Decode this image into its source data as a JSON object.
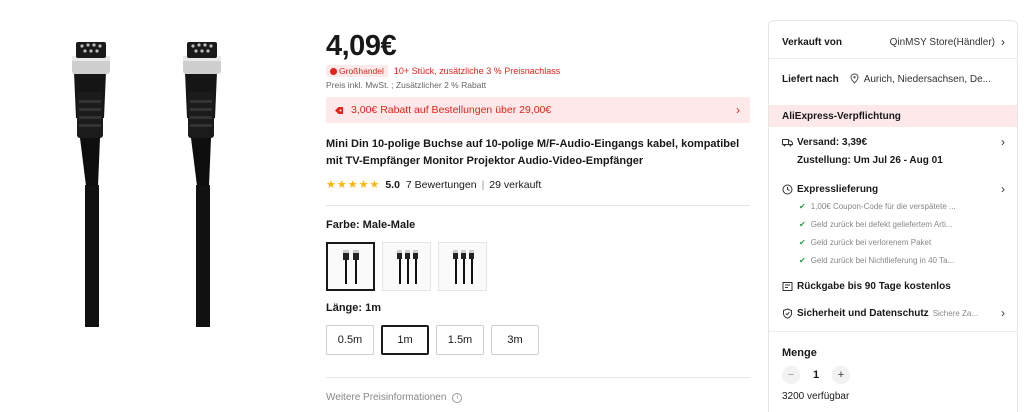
{
  "product": {
    "price": "4,09€",
    "bulk_badge": "Großhandel",
    "bulk_text": "10+ Stück, zusätzliche 3 % Preisnachlass",
    "tax_note": "Preis inkl. MwSt. ; Zusätzlicher 2 % Rabatt",
    "coupon_text": "3,00€ Rabatt auf Bestellungen über 29,00€",
    "title": "Mini Din 10-polige Buchse auf 10-polige M/F-Audio-Eingangs kabel, kompatibel mit TV-Empfänger Monitor Projektor Audio-Video-Empfänger",
    "stars": "★★★★★",
    "rating": "5.0",
    "reviews": "7 Bewertungen",
    "sold": "29 verkauft",
    "color_label": "Farbe: Male-Male",
    "color_swatch_count": 3,
    "length_label": "Länge: 1m",
    "length_options": [
      "0.5m",
      "1m",
      "1.5m",
      "3m"
    ],
    "length_selected": "1m",
    "more_price_info": "Weitere Preisinformationen"
  },
  "sidebar": {
    "seller_key": "Verkauft von",
    "seller_value": "QinMSY Store(Händler)",
    "ship_to_key": "Liefert nach",
    "ship_to_value": "Aurich, Niedersachsen, De...",
    "commitment_title": "AliExpress-Verpflichtung",
    "shipping": "Versand: 3,39€",
    "delivery": "Zustellung: Um Jul 26 - Aug 01",
    "express_title": "Expresslieferung",
    "guarantees": [
      "1,00€ Coupon-Code für die verspätete ...",
      "Geld zurück bei defekt geliefertem Arti...",
      "Geld zurück bei verlorenem Paket",
      "Geld zurück bei Nichtlieferung in 40 Ta..."
    ],
    "returns": "Rückgabe bis 90 Tage kostenlos",
    "security_title": "Sicherheit und Datenschutz",
    "security_sub": "Sichere Za...",
    "qty_label": "Menge",
    "qty_value": "1",
    "available": "3200 verfügbar"
  },
  "colors": {
    "accent": "#e1251b",
    "accent_bg": "#fde9ea",
    "star": "#ffb400",
    "check": "#2a9d4a"
  },
  "icons": [
    "tag-icon",
    "coupon-icon",
    "star-icon",
    "info-icon",
    "location-pin-icon",
    "truck-icon",
    "clock-icon",
    "return-icon",
    "shield-icon",
    "check-icon",
    "chevron-right-icon",
    "minus-icon",
    "plus-icon"
  ]
}
